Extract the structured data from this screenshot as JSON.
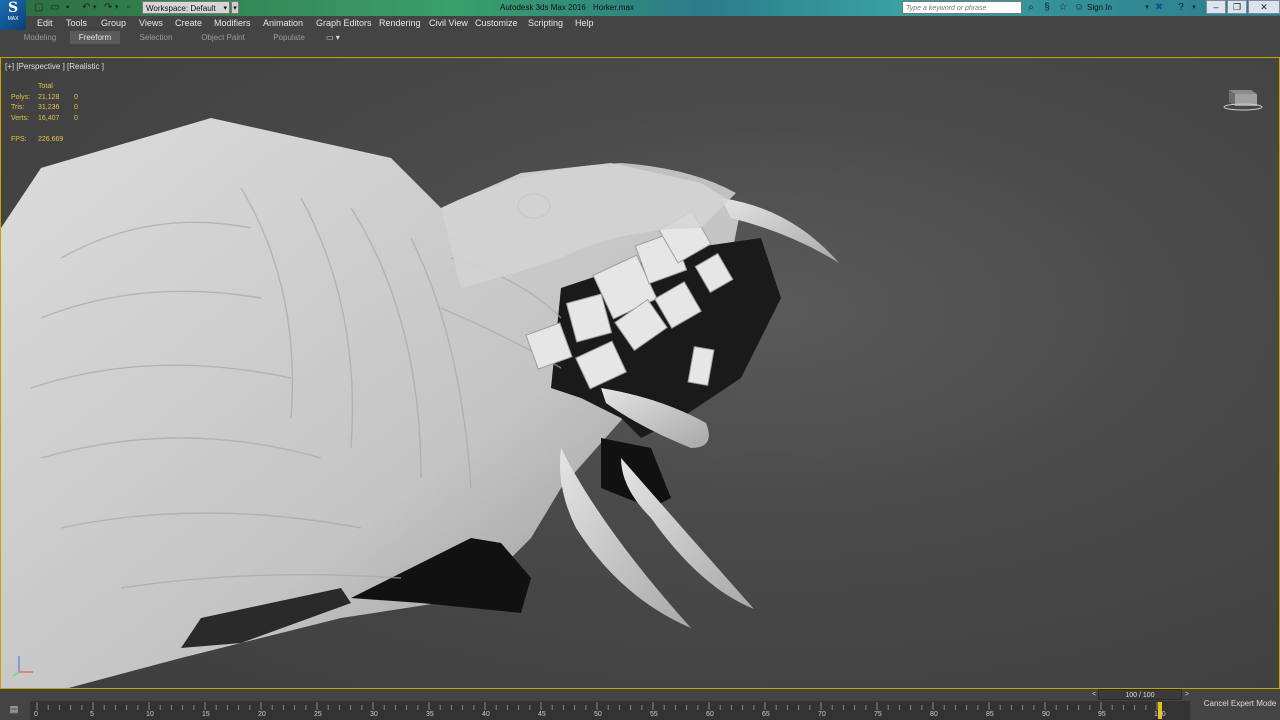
{
  "titlebar": {
    "logo_text": "MAX",
    "workspace_label": "Workspace: Default",
    "app_title": "Autodesk 3ds Max 2016",
    "file_title": "Horker.max",
    "search_placeholder": "Type a keyword or phrase",
    "signin_label": "Sign In",
    "help_label": "?",
    "win_minimize": "–",
    "win_restore": "❐",
    "win_close": "✕"
  },
  "menu": {
    "items": [
      "Edit",
      "Tools",
      "Group",
      "Views",
      "Create",
      "Modifiers",
      "Animation",
      "Graph Editors",
      "Rendering",
      "Civil View",
      "Customize",
      "Scripting",
      "Help"
    ]
  },
  "ribbon": {
    "tabs": [
      "Modeling",
      "Freeform",
      "Selection",
      "Object Paint",
      "Populate"
    ],
    "active_tab": "Freeform",
    "extra": "▭ ▾"
  },
  "viewport": {
    "label": "[+] [Perspective ] [Realistic ]",
    "stats": {
      "header": "Total",
      "rows": [
        {
          "label": "Polys:",
          "total": "21,128",
          "sel": "0"
        },
        {
          "label": "Tris:",
          "total": "31,236",
          "sel": "0"
        },
        {
          "label": "Verts:",
          "total": "16,407",
          "sel": "0"
        }
      ],
      "fps_label": "FPS:",
      "fps_value": "226.669"
    },
    "axis_z": "z",
    "axis_x": "x",
    "axis_y": "y",
    "accent_color": "#c8a200"
  },
  "timeline": {
    "slider_label": "100 / 100",
    "prev": "<",
    "next": ">",
    "ticks": [
      "0",
      "5",
      "10",
      "15",
      "20",
      "25",
      "30",
      "35",
      "40",
      "45",
      "50",
      "55",
      "60",
      "65",
      "70",
      "75",
      "80",
      "85",
      "90",
      "95",
      "100"
    ],
    "cancel_expert": "Cancel Expert Mode"
  }
}
